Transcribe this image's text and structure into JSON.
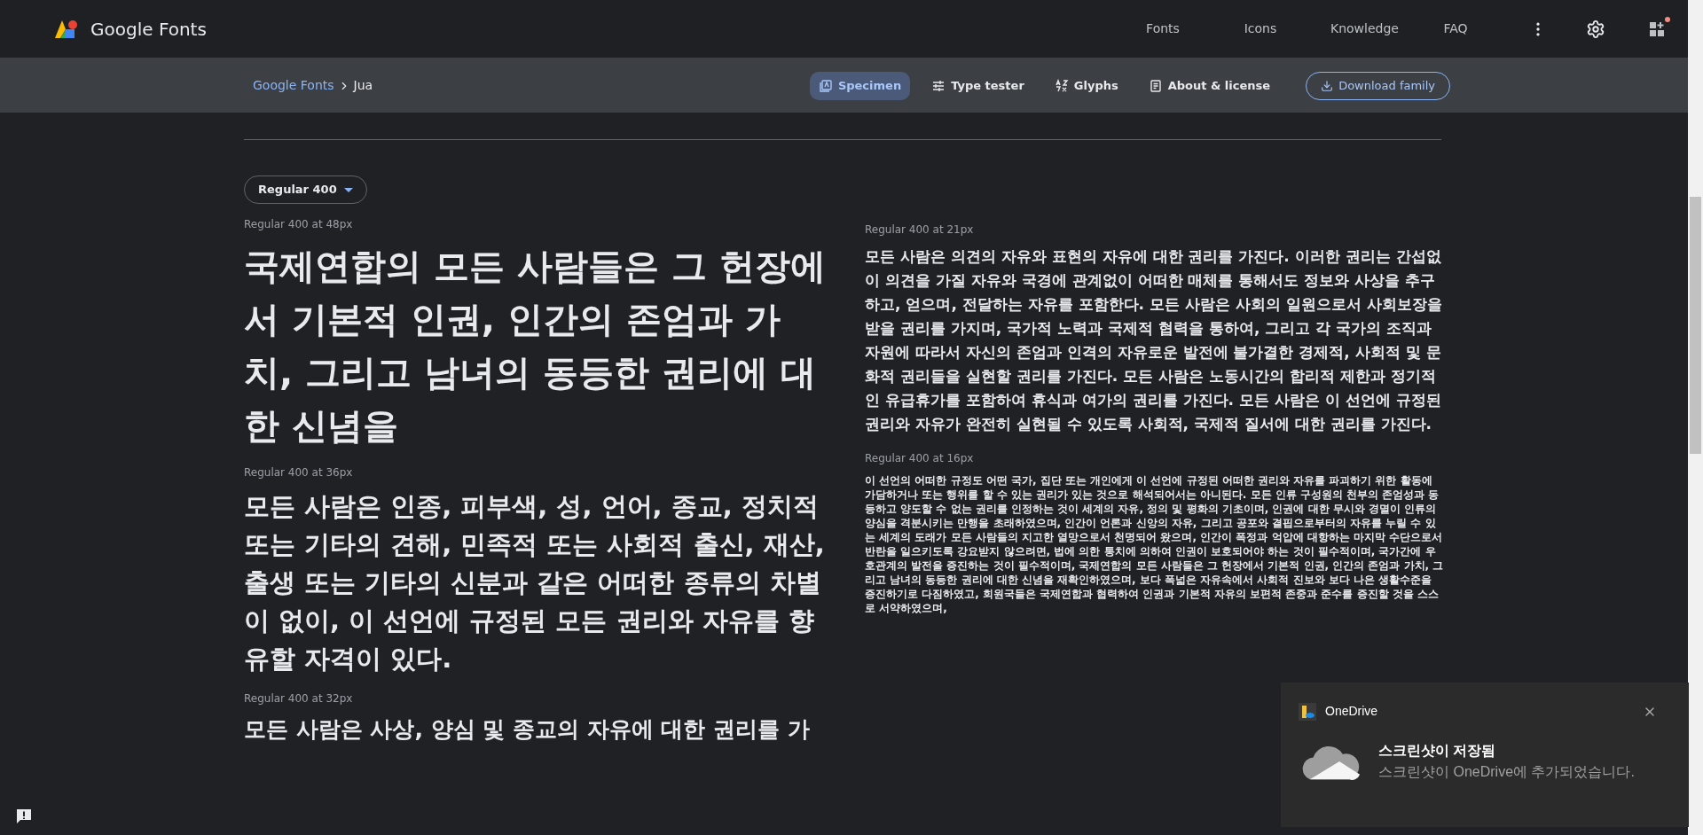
{
  "header": {
    "logo_text": "Google Fonts",
    "nav": [
      {
        "label": "Fonts"
      },
      {
        "label": "Icons"
      },
      {
        "label": "Knowledge"
      },
      {
        "label": "FAQ"
      }
    ],
    "apps_badge": true
  },
  "subheader": {
    "breadcrumb": [
      "Google Fonts",
      "Jua"
    ],
    "tabs": [
      {
        "label": "Specimen",
        "selected": true,
        "kind": "specimen"
      },
      {
        "label": "Type tester",
        "selected": false,
        "kind": "tester"
      },
      {
        "label": "Glyphs",
        "selected": false,
        "kind": "glyphs"
      },
      {
        "label": "About & license",
        "selected": false,
        "kind": "about"
      }
    ],
    "download": "Download family"
  },
  "style_select": {
    "value": "Regular 400"
  },
  "left_samples": [
    {
      "label": "Regular 400 at 48px",
      "kind": "display",
      "text": "국제연합의 모든 사람들은 그 헌장에서 기본적 인권, 인간의 존엄과 가치, 그리고 남녀의 동등한 권리에 대한 신념을"
    },
    {
      "label": "Regular 400 at 36px",
      "kind": "headline",
      "text": "모든 사람은 인종, 피부색, 성, 언어, 종교, 정치적 또는 기타의 견해, 민족적 또는 사회적 출신, 재산, 출생 또는 기타의 신분과 같은 어떠한 종류의 차별이 없이, 이 선언에 규정된 모든 권리와 자유를 향유할 자격이 있다."
    },
    {
      "label": "Regular 400 at 32px",
      "kind": "title",
      "text": "모든 사람은 사상, 양심 및 종교의 자유에 대한 권리를 가"
    }
  ],
  "right_samples": [
    {
      "label": "Regular 400 at 21px",
      "kind": "body",
      "text": "모든 사람은 의견의 자유와 표현의 자유에 대한 권리를 가진다. 이러한 권리는 간섭없이 의견을 가질 자유와 국경에 관계없이 어떠한 매체를 통해서도 정보와 사상을 추구하고, 얻으며, 전달하는 자유를 포함한다. 모든 사람은 사회의 일원으로서 사회보장을 받을 권리를 가지며, 국가적 노력과 국제적 협력을 통하여, 그리고 각 국가의 조직과 자원에 따라서 자신의 존엄과 인격의 자유로운 발전에 불가결한 경제적, 사회적 및 문화적 권리들을 실현할 권리를 가진다. 모든 사람은 노동시간의 합리적 제한과 정기적인 유급휴가를 포함하여 휴식과 여가의 권리를 가진다. 모든 사람은 이 선언에 규정된 권리와 자유가 완전히 실현될 수 있도록 사회적, 국제적 질서에 대한 권리를 가진다."
    },
    {
      "label": "Regular 400 at 16px",
      "kind": "small",
      "text": "이 선언의 어떠한 규정도 어떤 국가, 집단 또는 개인에게 이 선언에 규정된 어떠한 권리와 자유를 파괴하기 위한 활동에 가담하거나 또는 행위를 할 수 있는 권리가 있는 것으로 해석되어서는 아니된다. 모든 인류 구성원의 천부의 존엄성과 동등하고 양도할 수 없는 권리를 인정하는 것이 세계의 자유, 정의 및 평화의 기초이며, 인권에 대한 무시와 경멸이 인류의 양심을 격분시키는 만행을 초래하였으며, 인간이 언론과 신앙의 자유, 그리고 공포와 결핍으로부터의 자유를 누릴 수 있는 세계의 도래가 모든 사람들의 지고한 열망으로서 천명되어 왔으며, 인간이 폭정과 억압에 대항하는 마지막 수단으로서 반란을 일으키도록 강요받지 않으려면, 법에 의한 통치에 의하여 인권이 보호되어야 하는 것이 필수적이며, 국가간에 우호관계의 발전을 증진하는 것이 필수적이며, 국제연합의 모든 사람들은 그 헌장에서 기본적 인권, 인간의 존엄과 가치, 그리고 남녀의 동등한 권리에 대한 신념을 재확인하였으며, 보다 폭넓은 자유속에서 사회적 진보와 보다 나은 생활수준을 증진하기로 다짐하였고, 회원국들은 국제연합과 협력하여 인권과 기본적 자유의 보편적 존중과 준수를 증진할 것을 스스로 서약하였으며,"
    }
  ],
  "notification": {
    "app": "OneDrive",
    "title": "스크린샷이 저장됨",
    "body": "스크린샷이 OneDrive에 추가되었습니다."
  }
}
